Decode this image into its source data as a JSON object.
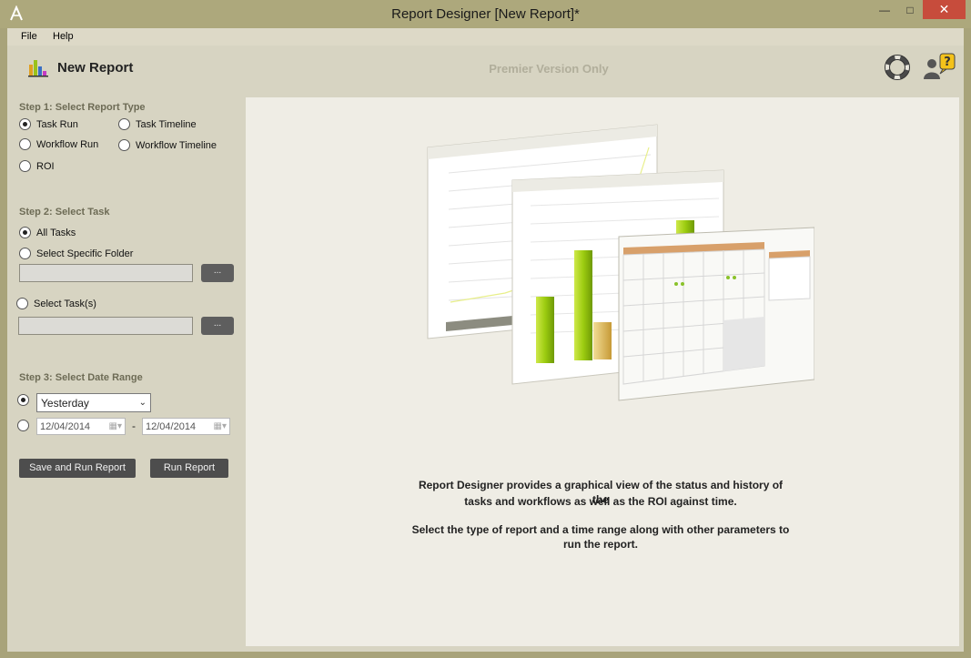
{
  "window": {
    "title": "Report Designer [New Report]*",
    "minimize_icon": "minimize-icon",
    "maximize_icon": "maximize-icon",
    "close_icon": "close-icon"
  },
  "menu": {
    "file": "File",
    "help": "Help"
  },
  "header": {
    "title": "New Report",
    "premier_note": "Premier Version Only"
  },
  "step1": {
    "label": "Step 1: Select Report Type",
    "options": [
      "Task Run",
      "Task Timeline",
      "Workflow Run",
      "Workflow Timeline",
      "ROI"
    ],
    "selected": "Task Run"
  },
  "step2": {
    "label": "Step 2: Select Task",
    "all_tasks": "All Tasks",
    "specific_folder": "Select Specific Folder",
    "select_tasks": "Select Task(s)",
    "browse_label": "...",
    "selected": "All Tasks"
  },
  "step3": {
    "label": "Step 3: Select Date Range",
    "range_value": "Yesterday",
    "start_date": "12/04/2014",
    "end_date": "12/04/2014",
    "separator": "-"
  },
  "actions": {
    "save_and_run": "Save and Run Report",
    "run": "Run Report"
  },
  "description": {
    "line1": "Report Designer provides a graphical view of the status and history of the",
    "line2": "tasks and workflows as well as the ROI against time.",
    "line3": "Select the type of report and a time range along with other parameters to",
    "line4": "run the report."
  },
  "colors": {
    "title_bar": "#ada87c",
    "panel": "#d7d4c2",
    "content": "#efede5",
    "accent_green": "#a8d41a",
    "button": "#4d4d4d",
    "close": "#c74c3c"
  }
}
